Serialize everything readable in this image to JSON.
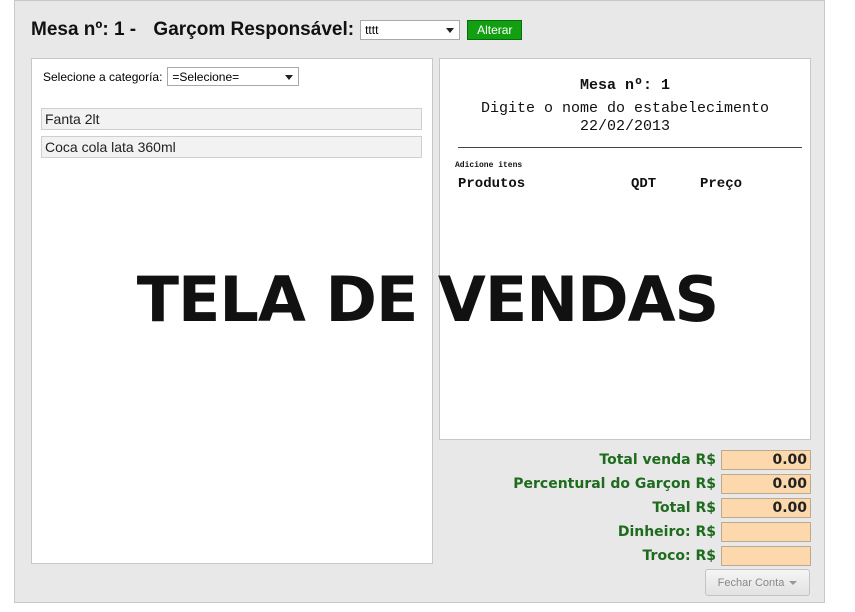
{
  "header": {
    "title": "Mesa nº: 1 - ",
    "waiter_label": "Garçom Responsável:",
    "waiter_selected": "tttt",
    "change_button": "Alterar"
  },
  "category": {
    "label": "Selecione a categoría:",
    "selected": "=Selecione="
  },
  "products": [
    {
      "name": "Fanta 2lt"
    },
    {
      "name": "Coca cola lata 360ml"
    }
  ],
  "receipt": {
    "table": "Mesa nº: 1",
    "establishment": "Digite o nome do estabelecimento",
    "date": "22/02/2013",
    "add_items": "Adicione itens",
    "col_products": "Produtos",
    "col_qty": "QDT",
    "col_price": "Preço"
  },
  "totals": [
    {
      "label": "Total venda R$",
      "value": "0.00"
    },
    {
      "label": "Percentural do Garçon R$",
      "value": "0.00"
    },
    {
      "label": "Total R$",
      "value": "0.00"
    },
    {
      "label": "Dinheiro: R$",
      "value": ""
    },
    {
      "label": "Troco: R$",
      "value": ""
    }
  ],
  "close_button": "Fechar Conta",
  "overlay_text": "TELA DE VENDAS",
  "colors": {
    "accent_green": "#12a012",
    "label_green": "#1e6b1e",
    "input_orange": "#fcd8ac",
    "panel_gray": "#e8e8e8"
  }
}
